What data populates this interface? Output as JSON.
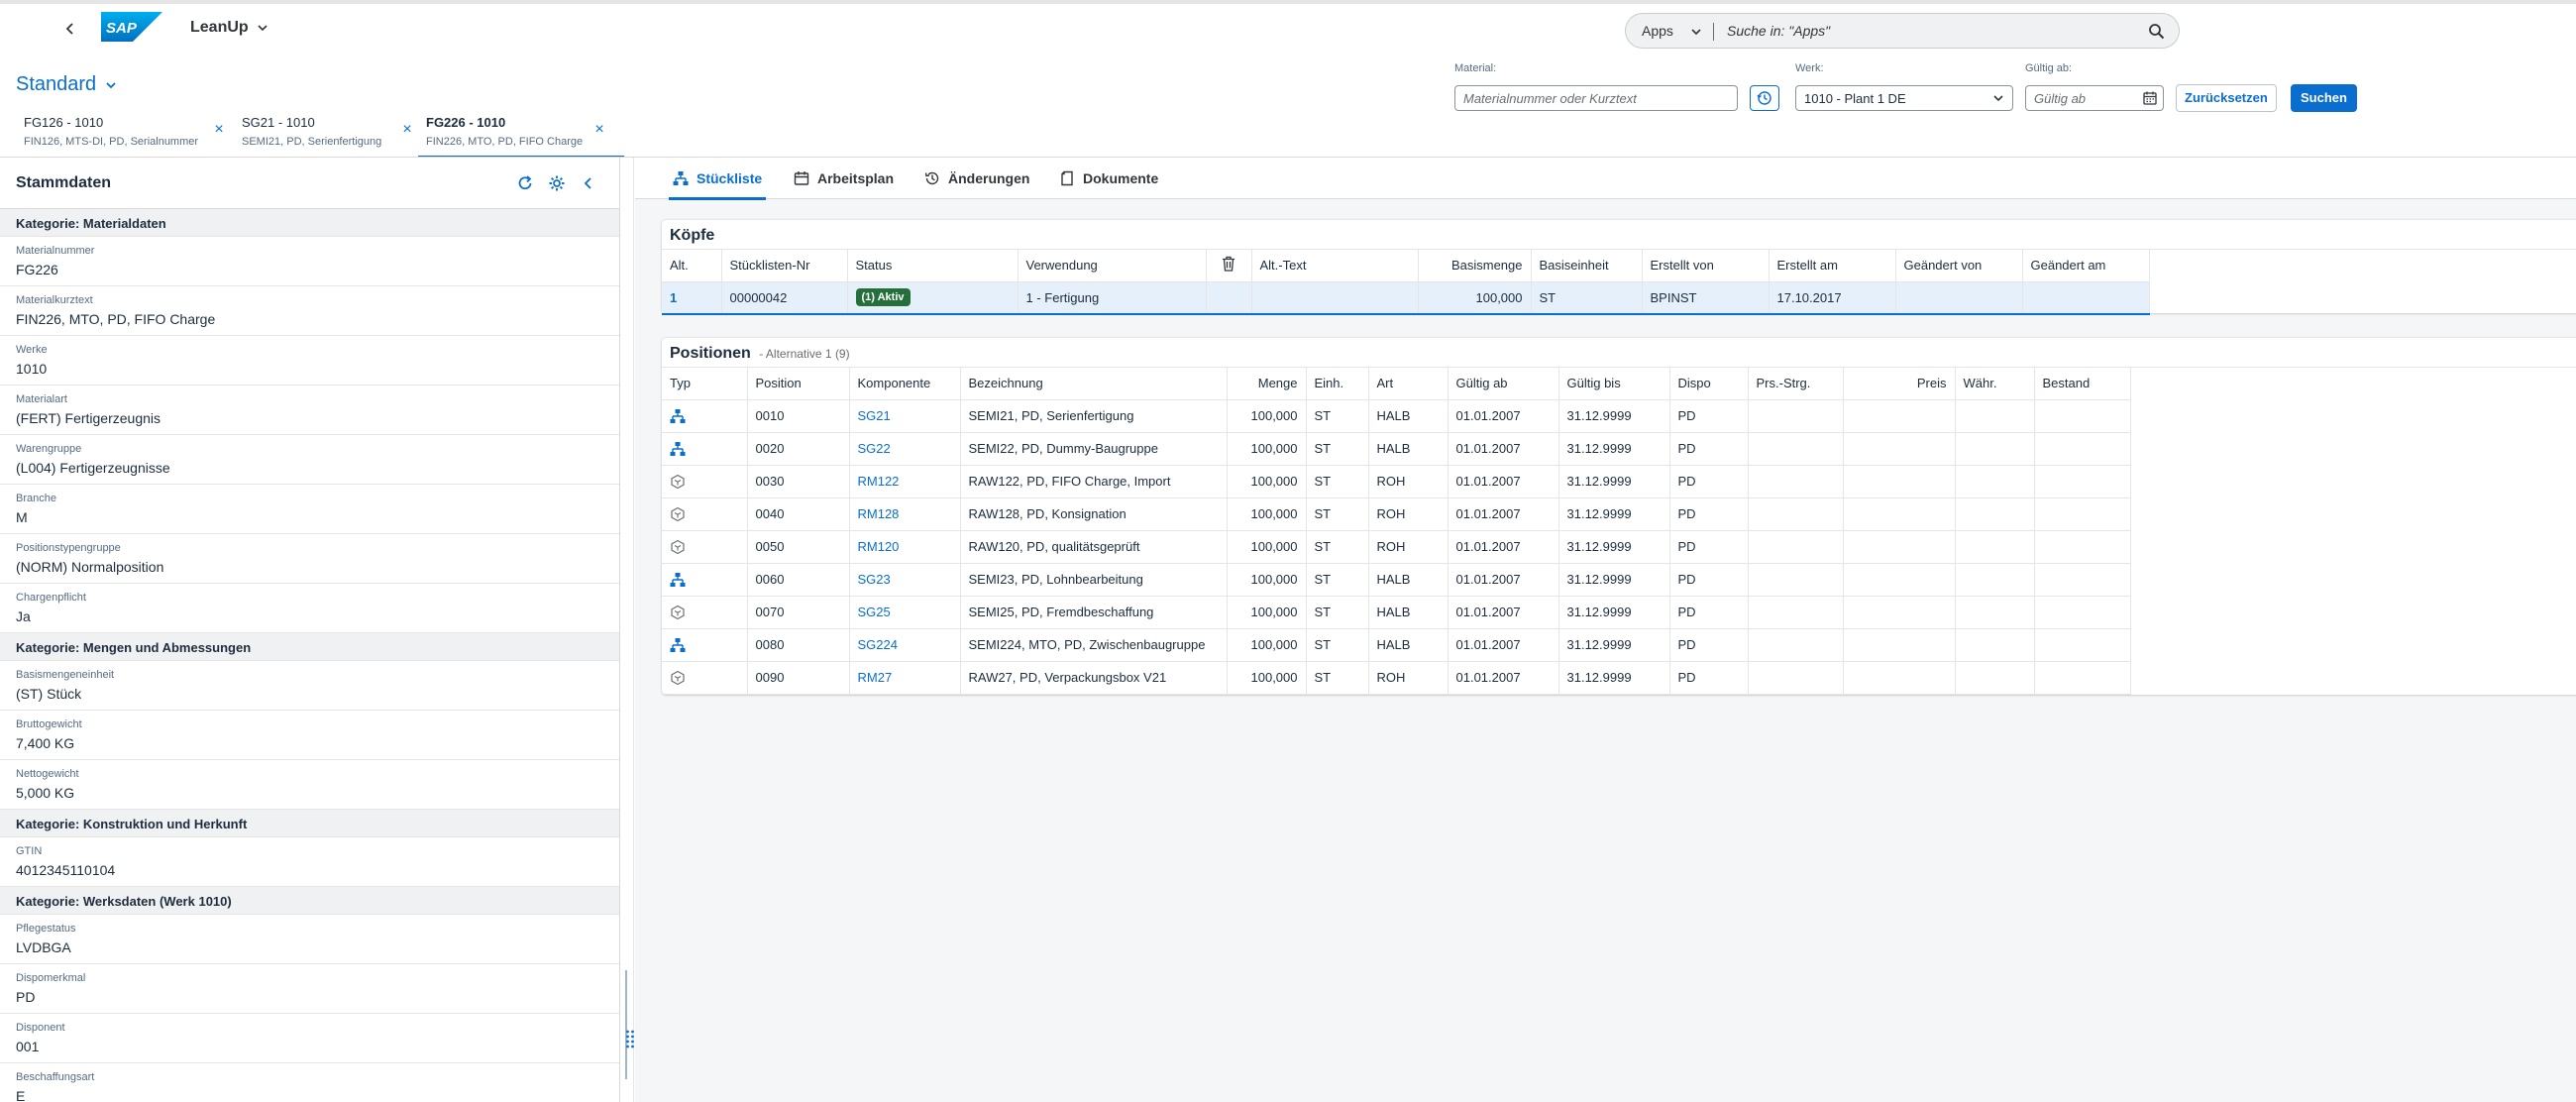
{
  "shell": {
    "app_name": "LeanUp",
    "search_scope": "Apps",
    "search_placeholder": "Suche in: \"Apps\""
  },
  "header": {
    "variant": "Standard",
    "material_label": "Material:",
    "material_placeholder": "Materialnummer oder Kurztext",
    "werk_label": "Werk:",
    "werk_value": "1010 - Plant 1 DE",
    "gueltig_label": "Gültig ab:",
    "gueltig_placeholder": "Gültig ab",
    "reset_label": "Zurücksetzen",
    "search_label": "Suchen"
  },
  "object_tabs": [
    {
      "title": "FG126 - 1010",
      "subtitle": "FIN126, MTS-DI, PD, Serialnummer",
      "active": false
    },
    {
      "title": "SG21 - 1010",
      "subtitle": "SEMI21, PD, Serienfertigung",
      "active": false
    },
    {
      "title": "FG226 - 1010",
      "subtitle": "FIN226, MTO, PD, FIFO Charge",
      "active": true
    }
  ],
  "left_panel": {
    "title": "Stammdaten",
    "sections": [
      {
        "category": "Kategorie: Materialdaten",
        "fields": [
          {
            "label": "Materialnummer",
            "value": "FG226"
          },
          {
            "label": "Materialkurztext",
            "value": "FIN226, MTO, PD, FIFO Charge"
          },
          {
            "label": "Werke",
            "value": "1010"
          },
          {
            "label": "Materialart",
            "value": "(FERT) Fertigerzeugnis"
          },
          {
            "label": "Warengruppe",
            "value": "(L004) Fertigerzeugnisse"
          },
          {
            "label": "Branche",
            "value": "M"
          },
          {
            "label": "Positionstypengruppe",
            "value": "(NORM) Normalposition"
          },
          {
            "label": "Chargenpflicht",
            "value": "Ja"
          }
        ]
      },
      {
        "category": "Kategorie: Mengen und Abmessungen",
        "fields": [
          {
            "label": "Basismengeneinheit",
            "value": "(ST) Stück"
          },
          {
            "label": "Bruttogewicht",
            "value": "7,400 KG"
          },
          {
            "label": "Nettogewicht",
            "value": "5,000 KG"
          }
        ]
      },
      {
        "category": "Kategorie: Konstruktion und Herkunft",
        "fields": [
          {
            "label": "GTIN",
            "value": "4012345110104"
          }
        ]
      },
      {
        "category": "Kategorie: Werksdaten (Werk 1010)",
        "fields": [
          {
            "label": "Pflegestatus",
            "value": "LVDBGA"
          },
          {
            "label": "Dispomerkmal",
            "value": "PD"
          },
          {
            "label": "Disponent",
            "value": "001"
          },
          {
            "label": "Beschaffungsart",
            "value": "E"
          }
        ]
      }
    ]
  },
  "nav_tabs": [
    {
      "label": "Stückliste",
      "icon": "hierarchy-icon",
      "active": true
    },
    {
      "label": "Arbeitsplan",
      "icon": "calendar-icon",
      "active": false
    },
    {
      "label": "Änderungen",
      "icon": "history-icon",
      "active": false
    },
    {
      "label": "Dokumente",
      "icon": "document-icon",
      "active": false
    }
  ],
  "koepfe": {
    "title": "Köpfe",
    "columns": [
      "Alt.",
      "Stücklisten-Nr",
      "Status",
      "Verwendung",
      "",
      "Alt.-Text",
      "Basismenge",
      "Basiseinheit",
      "Erstellt von",
      "Erstellt am",
      "Geändert von",
      "Geändert am"
    ],
    "rows": [
      {
        "alt": "1",
        "nr": "00000042",
        "status": "(1) Aktiv",
        "verwendung": "1 - Fertigung",
        "alttext": "",
        "basismenge": "100,000",
        "basiseinheit": "ST",
        "erstellt_von": "BPINST",
        "erstellt_am": "17.10.2017",
        "geaendert_von": "",
        "geaendert_am": ""
      }
    ]
  },
  "positionen": {
    "title": "Positionen",
    "subtitle": "- Alternative 1 (9)",
    "columns": [
      "Typ",
      "Position",
      "Komponente",
      "Bezeichnung",
      "Menge",
      "Einh.",
      "Art",
      "Gültig ab",
      "Gültig bis",
      "Dispo",
      "Prs.-Strg.",
      "Preis",
      "Währ.",
      "Bestand"
    ],
    "rows": [
      {
        "typ": "bom-icon",
        "pos": "0010",
        "komp": "SG21",
        "bez": "SEMI21, PD, Serienfertigung",
        "menge": "100,000",
        "einh": "ST",
        "art": "HALB",
        "ab": "01.01.2007",
        "bis": "31.12.9999",
        "dispo": "PD"
      },
      {
        "typ": "bom-icon",
        "pos": "0020",
        "komp": "SG22",
        "bez": "SEMI22, PD, Dummy-Baugruppe",
        "menge": "100,000",
        "einh": "ST",
        "art": "HALB",
        "ab": "01.01.2007",
        "bis": "31.12.9999",
        "dispo": "PD"
      },
      {
        "typ": "material-icon",
        "pos": "0030",
        "komp": "RM122",
        "bez": "RAW122, PD, FIFO Charge, Import",
        "menge": "100,000",
        "einh": "ST",
        "art": "ROH",
        "ab": "01.01.2007",
        "bis": "31.12.9999",
        "dispo": "PD"
      },
      {
        "typ": "material-icon",
        "pos": "0040",
        "komp": "RM128",
        "bez": "RAW128, PD, Konsignation",
        "menge": "100,000",
        "einh": "ST",
        "art": "ROH",
        "ab": "01.01.2007",
        "bis": "31.12.9999",
        "dispo": "PD"
      },
      {
        "typ": "material-icon",
        "pos": "0050",
        "komp": "RM120",
        "bez": "RAW120, PD, qualitätsgeprüft",
        "menge": "100,000",
        "einh": "ST",
        "art": "ROH",
        "ab": "01.01.2007",
        "bis": "31.12.9999",
        "dispo": "PD"
      },
      {
        "typ": "bom-icon",
        "pos": "0060",
        "komp": "SG23",
        "bez": "SEMI23, PD, Lohnbearbeitung",
        "menge": "100,000",
        "einh": "ST",
        "art": "HALB",
        "ab": "01.01.2007",
        "bis": "31.12.9999",
        "dispo": "PD"
      },
      {
        "typ": "material-icon",
        "pos": "0070",
        "komp": "SG25",
        "bez": "SEMI25, PD, Fremdbeschaffung",
        "menge": "100,000",
        "einh": "ST",
        "art": "HALB",
        "ab": "01.01.2007",
        "bis": "31.12.9999",
        "dispo": "PD"
      },
      {
        "typ": "bom-icon",
        "pos": "0080",
        "komp": "SG224",
        "bez": "SEMI224, MTO, PD, Zwischenbaugruppe",
        "menge": "100,000",
        "einh": "ST",
        "art": "HALB",
        "ab": "01.01.2007",
        "bis": "31.12.9999",
        "dispo": "PD"
      },
      {
        "typ": "material-icon",
        "pos": "0090",
        "komp": "RM27",
        "bez": "RAW27, PD, Verpackungsbox V21",
        "menge": "100,000",
        "einh": "ST",
        "art": "ROH",
        "ab": "01.01.2007",
        "bis": "31.12.9999",
        "dispo": "PD"
      }
    ]
  },
  "colors": {
    "accent": "#0a6ed1",
    "status_active": "#256f3a",
    "selected_row": "#e5f0fa"
  }
}
